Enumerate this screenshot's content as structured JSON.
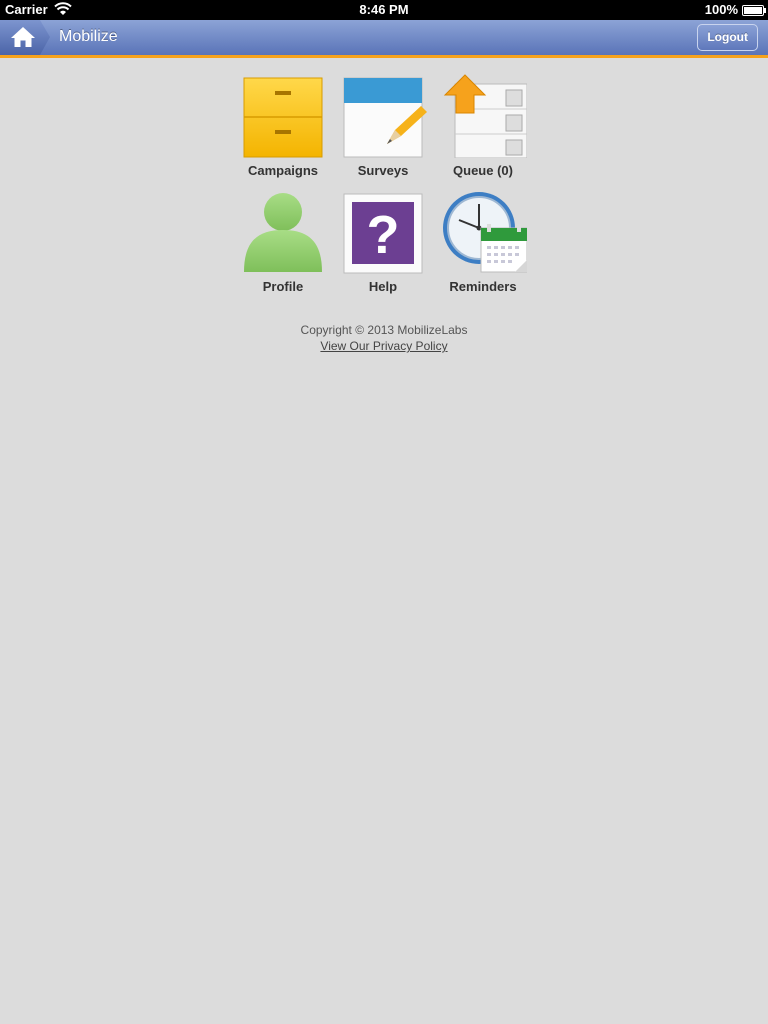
{
  "status_bar": {
    "carrier": "Carrier",
    "time": "8:46 PM",
    "battery": "100%"
  },
  "header": {
    "title": "Mobilize",
    "logout_label": "Logout",
    "accent_color": "#f6a21c"
  },
  "tiles": [
    {
      "label": "Campaigns",
      "icon": "file-cabinet-icon"
    },
    {
      "label": "Surveys",
      "icon": "survey-pencil-icon"
    },
    {
      "label": "Queue (0)",
      "icon": "upload-queue-icon"
    },
    {
      "label": "Profile",
      "icon": "user-silhouette-icon"
    },
    {
      "label": "Help",
      "icon": "question-mark-icon"
    },
    {
      "label": "Reminders",
      "icon": "clock-calendar-icon"
    }
  ],
  "footer": {
    "copyright": "Copyright © 2013 MobilizeLabs",
    "privacy_link": "View Our Privacy Policy"
  }
}
